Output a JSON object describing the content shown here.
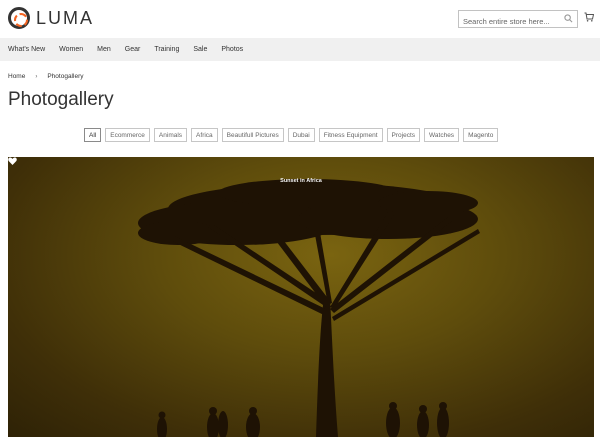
{
  "header": {
    "logo_text": "LUMA",
    "search_placeholder": "Search entire store here..."
  },
  "nav": {
    "items": [
      "What's New",
      "Women",
      "Men",
      "Gear",
      "Training",
      "Sale",
      "Photos"
    ]
  },
  "breadcrumb": {
    "home": "Home",
    "current": "Photogallery"
  },
  "page_title": "Photogallery",
  "filters": {
    "active": "All",
    "items": [
      "All",
      "Ecommerce",
      "Animals",
      "Africa",
      "Beautifull Pictures",
      "Dubai",
      "Fitness Equipment",
      "Projects",
      "Watches",
      "Magento"
    ]
  },
  "gallery": {
    "caption": "Sunset in Africa"
  },
  "colors": {
    "nav_bg": "#f0f0f0",
    "photo_tone": "#5e4c0c",
    "logo_accent": "#f26322"
  }
}
